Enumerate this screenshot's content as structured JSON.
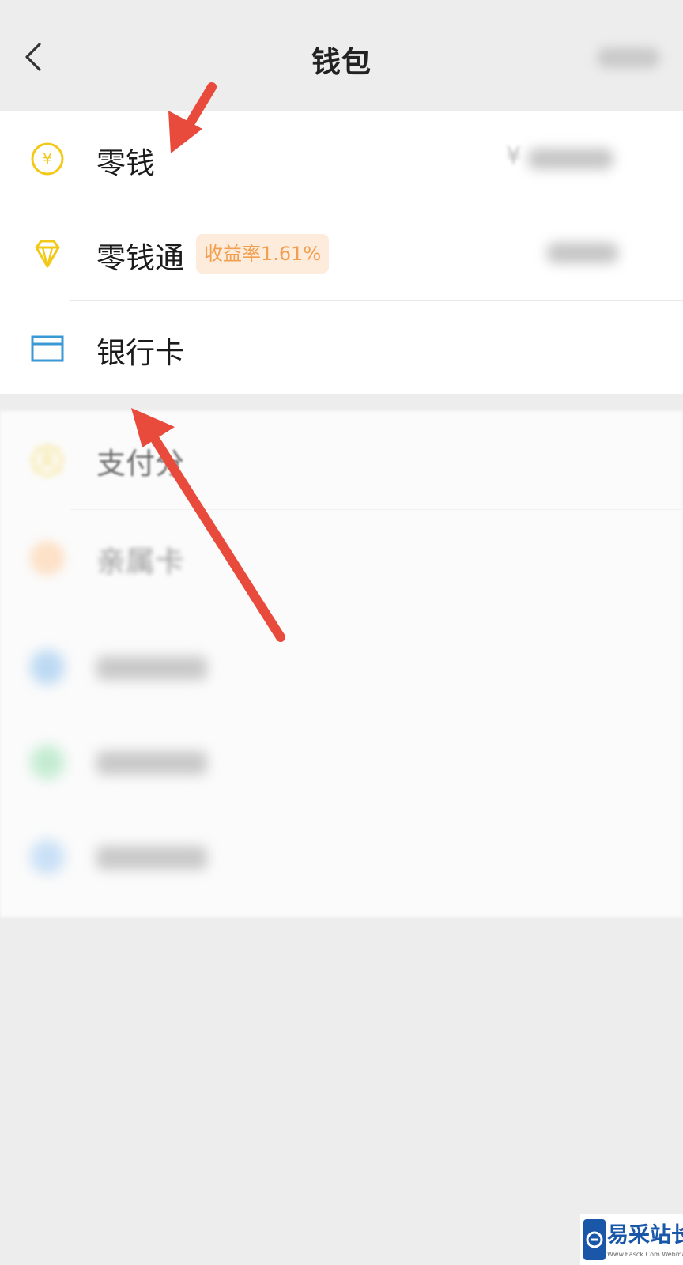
{
  "header": {
    "title": "钱包"
  },
  "wallet_items": [
    {
      "label": "零钱"
    },
    {
      "label": "零钱通",
      "badge": "收益率1.61%"
    },
    {
      "label": "银行卡"
    }
  ],
  "services": [
    {
      "label": "支付分"
    },
    {
      "label": "亲属卡"
    }
  ],
  "balance_prefix": "¥",
  "watermark": {
    "text": "易采站长站",
    "subtext": "Www.Easck.Com Webmaster"
  },
  "colors": {
    "accent_yellow": "#f2c919",
    "arrow_red": "#e84a3b",
    "badge_text": "#f0a050",
    "card_blue": "#3a98d4"
  },
  "icons": [
    "back-icon",
    "yuan-coin-icon",
    "diamond-icon",
    "bank-card-icon",
    "credit-score-icon",
    "family-card-icon"
  ]
}
